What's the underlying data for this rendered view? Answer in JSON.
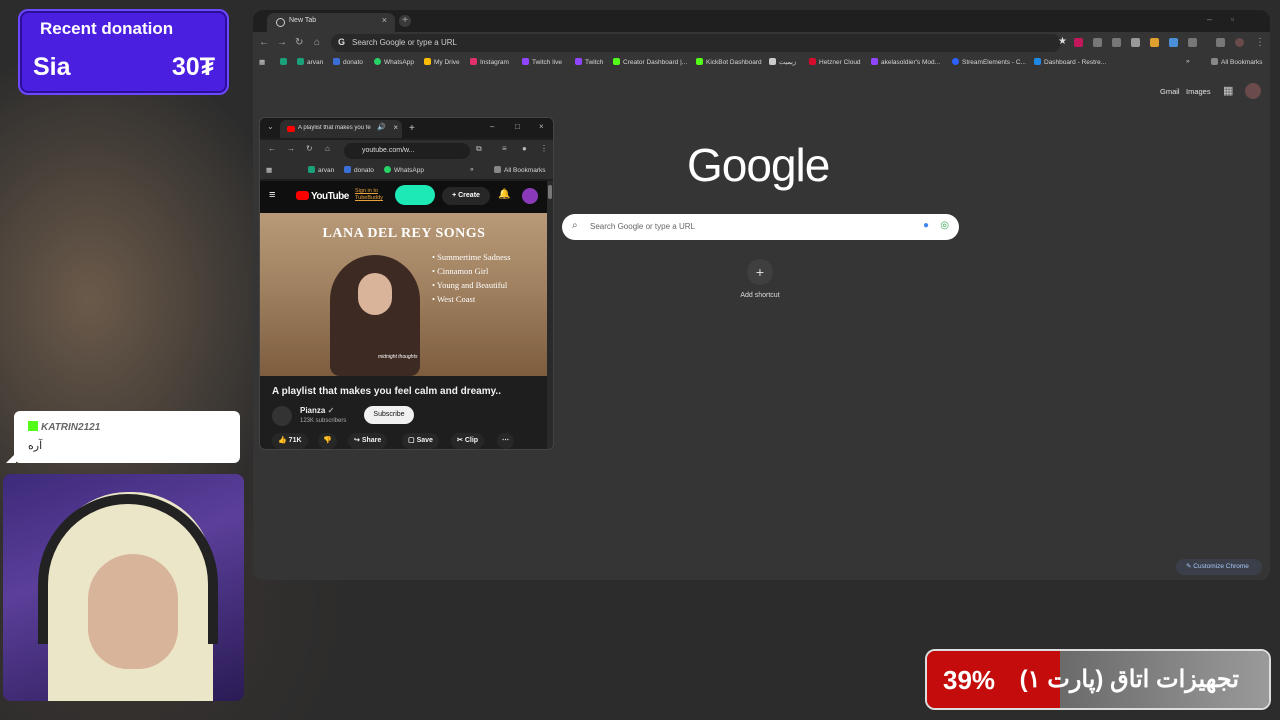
{
  "overlay": {
    "donation": {
      "title": "Recent donation",
      "name": "Sia",
      "amount": "30₮"
    },
    "chat": {
      "user": "KATRIN2121",
      "message": "آره"
    },
    "goal": {
      "percent_label": "39%",
      "percent_value": 0.39,
      "text": "تجهیزات اتاق (پارت ۱)"
    }
  },
  "browser": {
    "tab": {
      "title": "New Tab"
    },
    "omnibox": {
      "text": "Search Google or type a URL"
    },
    "bookmarks": [
      {
        "label": "arvan",
        "color": "#1aa179"
      },
      {
        "label": "donato",
        "color": "#3a6fd8"
      },
      {
        "label": "WhatsApp",
        "color": "#25d366"
      },
      {
        "label": "My Drive",
        "color": "#fbbc04"
      },
      {
        "label": "Instagram",
        "color": "#e1306c"
      },
      {
        "label": "Twitch live",
        "color": "#9146ff"
      },
      {
        "label": "Twitch",
        "color": "#9146ff"
      },
      {
        "label": "Creator Dashboard |...",
        "color": "#53fc18"
      },
      {
        "label": "KickBot Dashboard",
        "color": "#53fc18"
      },
      {
        "label": "زیمیت",
        "color": "#444444"
      },
      {
        "label": "Hetzner Cloud",
        "color": "#d50c2d"
      },
      {
        "label": "akelasoldier's Mod...",
        "color": "#9146ff"
      },
      {
        "label": "StreamElements - C...",
        "color": "#2d62ff"
      },
      {
        "label": "Dashboard - Restre...",
        "color": "#1e88e5"
      }
    ],
    "all_bookmarks": "All Bookmarks",
    "top_links": {
      "gmail": "Gmail",
      "images": "Images"
    },
    "google_logo": "Google",
    "search_placeholder": "Search Google or type a URL",
    "add_shortcut": "Add shortcut",
    "customize": "Customize Chrome"
  },
  "mini_window": {
    "tab_title": "A playlist that makes you fe",
    "url": "youtube.com/w...",
    "bookmarks": [
      "arvan",
      "donato",
      "WhatsApp"
    ],
    "all_bookmarks": "All Bookmarks",
    "youtube": {
      "logo": "YouTube",
      "signin": "Sign in to TubeBuddy",
      "create": "Create",
      "thumbnail": {
        "title": "LANA DEL REY SONGS",
        "songs": [
          "Summertime Sadness",
          "Cinnamon Girl",
          "Young and Beautiful",
          "West Coast"
        ],
        "signature": "midnight thoughts"
      },
      "video_title": "A playlist that makes you feel calm and dreamy..",
      "channel": "Pianza",
      "subscribers": "123K subscribers",
      "subscribe": "Subscribe",
      "likes": "71K",
      "share": "Share",
      "save": "Save",
      "clip": "Clip"
    }
  }
}
